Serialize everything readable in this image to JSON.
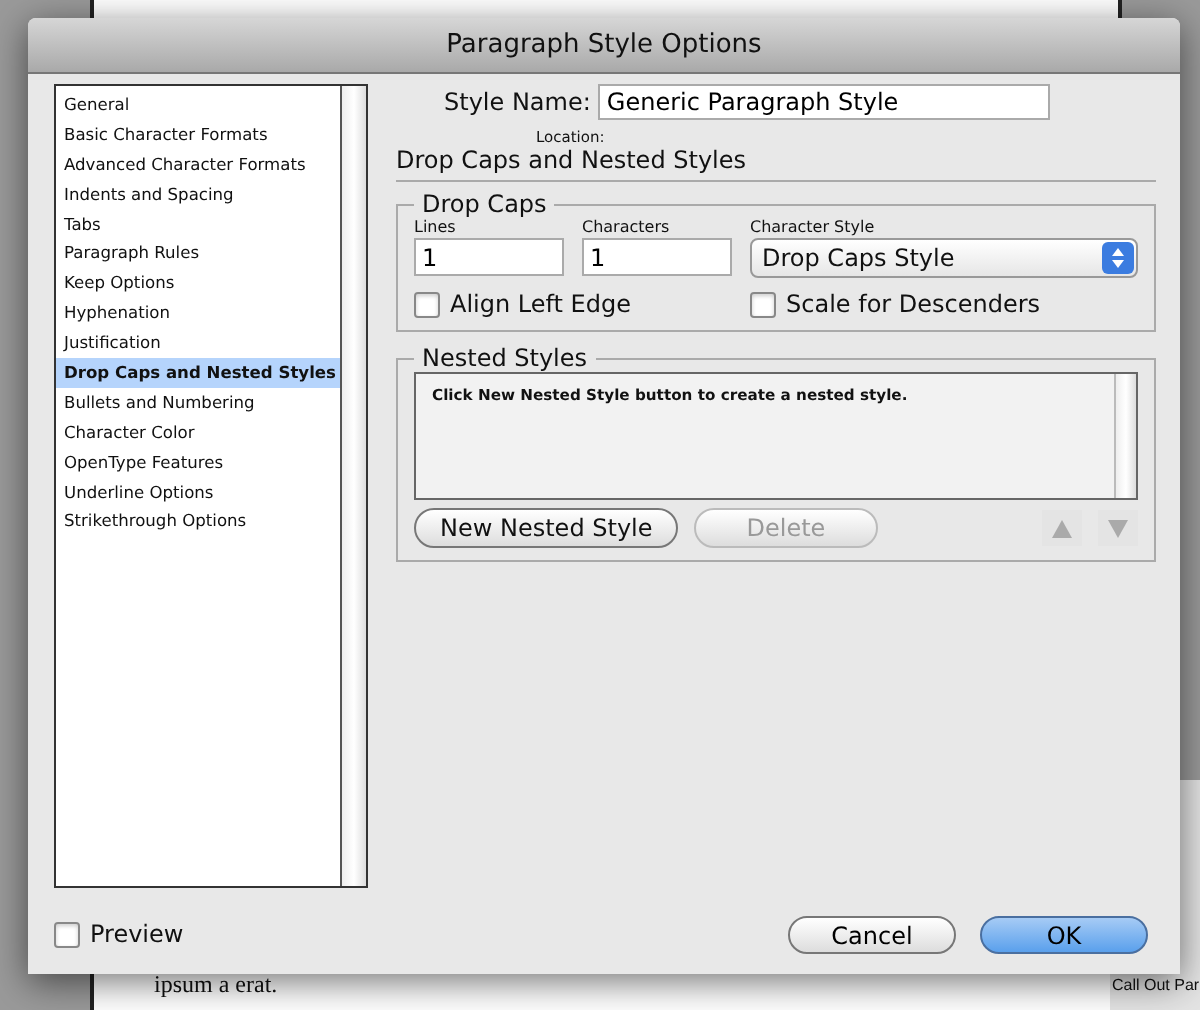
{
  "background": {
    "document_text": "ipsum a erat.",
    "side_panel_text": "Call Out Par"
  },
  "window": {
    "title": "Paragraph Style Options"
  },
  "sidebar": {
    "items": [
      {
        "label": "General",
        "selected": false
      },
      {
        "label": "Basic Character Formats",
        "selected": false
      },
      {
        "label": "Advanced Character Formats",
        "selected": false
      },
      {
        "label": "Indents and Spacing",
        "selected": false
      },
      {
        "label": "Tabs",
        "selected": false
      },
      {
        "label": "Paragraph Rules",
        "selected": false
      },
      {
        "label": "Keep Options",
        "selected": false
      },
      {
        "label": "Hyphenation",
        "selected": false
      },
      {
        "label": "Justification",
        "selected": false
      },
      {
        "label": "Drop Caps and Nested Styles",
        "selected": true
      },
      {
        "label": "Bullets and Numbering",
        "selected": false
      },
      {
        "label": "Character Color",
        "selected": false
      },
      {
        "label": "OpenType Features",
        "selected": false
      },
      {
        "label": "Underline Options",
        "selected": false
      },
      {
        "label": "Strikethrough Options",
        "selected": false
      }
    ]
  },
  "style_name": {
    "label": "Style Name:",
    "value": "Generic Paragraph Style"
  },
  "location_label": "Location:",
  "section_title": "Drop Caps and Nested Styles",
  "drop_caps": {
    "title": "Drop Caps",
    "lines": {
      "label": "Lines",
      "value": "1"
    },
    "characters": {
      "label": "Characters",
      "value": "1"
    },
    "character_style": {
      "label": "Character Style",
      "value": "Drop Caps Style"
    },
    "checkboxes": [
      {
        "label": "Align Left Edge",
        "checked": false
      },
      {
        "label": "Scale for Descenders",
        "checked": false
      }
    ]
  },
  "nested_styles": {
    "title": "Nested Styles",
    "hint": "Click New Nested Style button to create a nested style.",
    "buttons": [
      {
        "label": "New Nested Style",
        "disabled": false
      },
      {
        "label": "Delete",
        "disabled": true
      }
    ],
    "move_up_disabled": true,
    "move_down_disabled": true
  },
  "preview": {
    "label": "Preview",
    "checked": false
  },
  "footer_buttons": [
    {
      "label": "Cancel",
      "kind": "cancel"
    },
    {
      "label": "OK",
      "kind": "default"
    }
  ]
}
